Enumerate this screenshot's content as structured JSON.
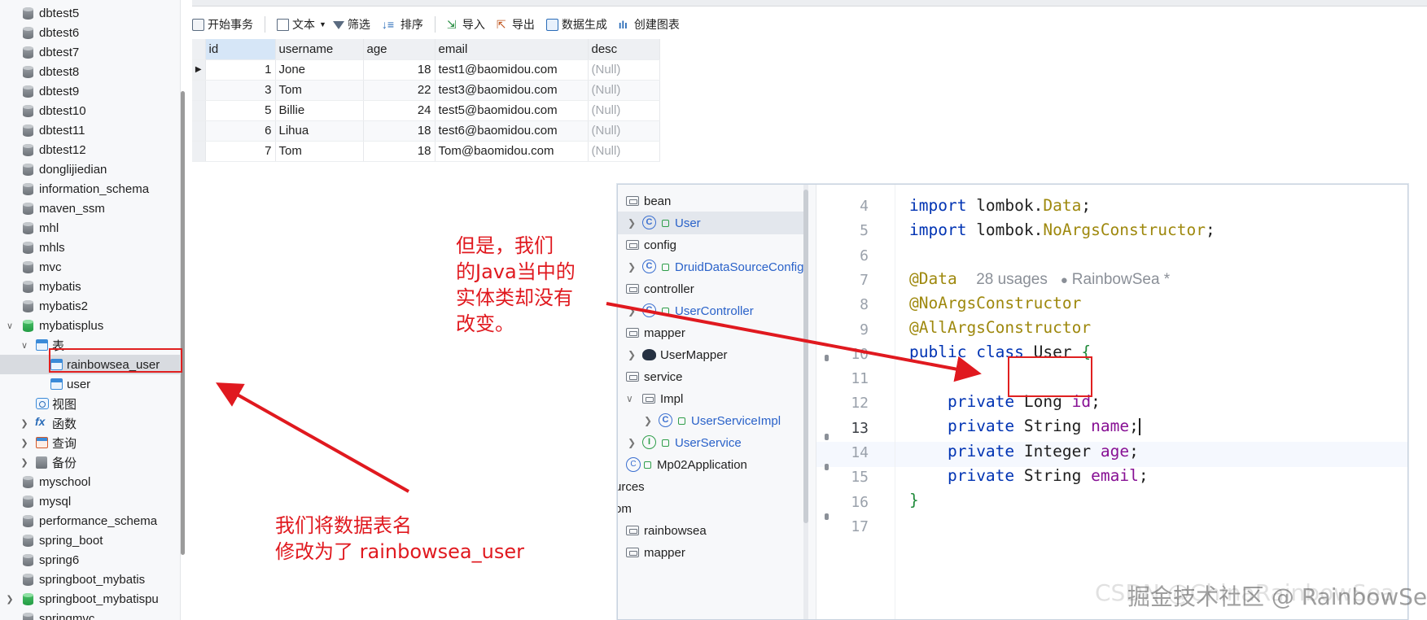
{
  "sidebar": {
    "items": [
      {
        "label": "dbtest5",
        "kind": "db"
      },
      {
        "label": "dbtest6",
        "kind": "db"
      },
      {
        "label": "dbtest7",
        "kind": "db"
      },
      {
        "label": "dbtest8",
        "kind": "db"
      },
      {
        "label": "dbtest9",
        "kind": "db"
      },
      {
        "label": "dbtest10",
        "kind": "db"
      },
      {
        "label": "dbtest11",
        "kind": "db"
      },
      {
        "label": "dbtest12",
        "kind": "db"
      },
      {
        "label": "donglijiedian",
        "kind": "db"
      },
      {
        "label": "information_schema",
        "kind": "db"
      },
      {
        "label": "maven_ssm",
        "kind": "db"
      },
      {
        "label": "mhl",
        "kind": "db"
      },
      {
        "label": "mhls",
        "kind": "db"
      },
      {
        "label": "mvc",
        "kind": "db"
      },
      {
        "label": "mybatis",
        "kind": "db"
      },
      {
        "label": "mybatis2",
        "kind": "db"
      },
      {
        "label": "mybatisplus",
        "kind": "db-open"
      },
      {
        "label": "表",
        "kind": "tables-group"
      },
      {
        "label": "rainbowsea_user",
        "kind": "table",
        "selected": true
      },
      {
        "label": "user",
        "kind": "table"
      },
      {
        "label": "视图",
        "kind": "views"
      },
      {
        "label": "函数",
        "kind": "functions"
      },
      {
        "label": "查询",
        "kind": "queries"
      },
      {
        "label": "备份",
        "kind": "backups"
      },
      {
        "label": "myschool",
        "kind": "db"
      },
      {
        "label": "mysql",
        "kind": "db"
      },
      {
        "label": "performance_schema",
        "kind": "db"
      },
      {
        "label": "spring_boot",
        "kind": "db"
      },
      {
        "label": "spring6",
        "kind": "db"
      },
      {
        "label": "springboot_mybatis",
        "kind": "db"
      },
      {
        "label": "springboot_mybatispu",
        "kind": "db-open"
      },
      {
        "label": "springmvc",
        "kind": "db"
      }
    ]
  },
  "toolbar": {
    "begin_txn": "开始事务",
    "text": "文本",
    "filter": "筛选",
    "sort": "排序",
    "import": "导入",
    "export": "导出",
    "data_gen": "数据生成",
    "create_chart": "创建图表"
  },
  "grid": {
    "columns": [
      "id",
      "username",
      "age",
      "email",
      "desc"
    ],
    "rows": [
      {
        "id": "1",
        "username": "Jone",
        "age": "18",
        "email": "test1@baomidou.com",
        "desc": "(Null)"
      },
      {
        "id": "3",
        "username": "Tom",
        "age": "22",
        "email": "test3@baomidou.com",
        "desc": "(Null)"
      },
      {
        "id": "5",
        "username": "Billie",
        "age": "24",
        "email": "test5@baomidou.com",
        "desc": "(Null)"
      },
      {
        "id": "6",
        "username": "Lihua",
        "age": "18",
        "email": "test6@baomidou.com",
        "desc": "(Null)"
      },
      {
        "id": "7",
        "username": "Tom",
        "age": "18",
        "email": "Tom@baomidou.com",
        "desc": "(Null)"
      }
    ]
  },
  "ide_tree": {
    "items": [
      {
        "label": "bean",
        "kind": "folder"
      },
      {
        "label": "User",
        "kind": "class",
        "selected": true
      },
      {
        "label": "config",
        "kind": "folder"
      },
      {
        "label": "DruidDataSourceConfig",
        "kind": "class"
      },
      {
        "label": "controller",
        "kind": "folder"
      },
      {
        "label": "UserController",
        "kind": "class"
      },
      {
        "label": "mapper",
        "kind": "folder"
      },
      {
        "label": "UserMapper",
        "kind": "mapper"
      },
      {
        "label": "service",
        "kind": "folder"
      },
      {
        "label": "Impl",
        "kind": "folder"
      },
      {
        "label": "UserServiceImpl",
        "kind": "class"
      },
      {
        "label": "UserService",
        "kind": "interface"
      },
      {
        "label": "Mp02Application",
        "kind": "app"
      },
      {
        "label": "urces",
        "kind": "text"
      },
      {
        "label": "om",
        "kind": "text"
      },
      {
        "label": "rainbowsea",
        "kind": "folder"
      },
      {
        "label": "mapper",
        "kind": "folder"
      }
    ]
  },
  "editor": {
    "line_numbers": [
      "4",
      "5",
      "6",
      "7",
      "8",
      "9",
      "10",
      "11",
      "12",
      "13",
      "14",
      "15",
      "16",
      "17"
    ],
    "current_line": "13",
    "code": {
      "l4_kw": "import",
      "l4_pkg": " lombok.",
      "l4_cls": "Data",
      "l4_end": ";",
      "l5_kw": "import",
      "l5_pkg": " lombok.",
      "l5_cls": "NoArgsConstructor",
      "l5_end": ";",
      "l7_ann": "@Data",
      "l7_hint_usages": "28 usages",
      "l7_hint_author": "RainbowSea *",
      "l8_ann": "@NoArgsConstructor",
      "l9_ann": "@AllArgsConstructor",
      "l10_kw1": "public",
      "l10_kw2": "class",
      "l10_name": "User",
      "l10_brace": "{",
      "l12_kw": "private",
      "l12_type": "Long",
      "l12_field": "id",
      "l12_end": ";",
      "l13_kw": "private",
      "l13_type": "String",
      "l13_field": "name",
      "l13_end": ";",
      "l14_kw": "private",
      "l14_type": "Integer",
      "l14_field": "age",
      "l14_end": ";",
      "l15_kw": "private",
      "l15_type": "String",
      "l15_field": "email",
      "l15_end": ";",
      "l16_brace": "}"
    }
  },
  "annotations": {
    "note_java": "但是，我们\n的Java当中的\n实体类却没有\n改变。",
    "note_rename": "我们将数据表名\n修改为了 rainbowsea_user",
    "color": "#e0191f"
  },
  "watermark": {
    "back": "CSDN @ChinaRainbowSea",
    "front": "掘金技术社区 @ RainbowSea"
  }
}
